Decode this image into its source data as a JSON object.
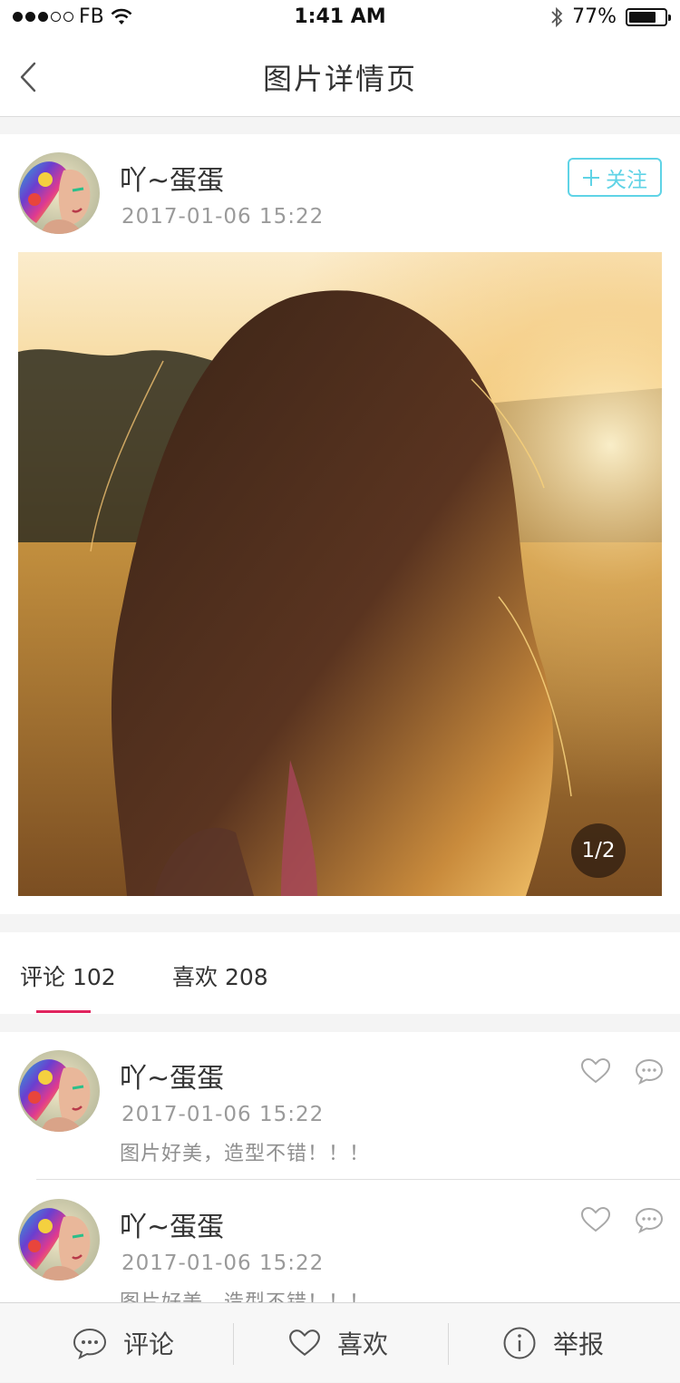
{
  "status_bar": {
    "carrier": "FB",
    "time": "1:41 AM",
    "battery": "77%",
    "battery_level": 0.77,
    "signal_filled": 3,
    "signal_total": 5
  },
  "nav": {
    "title": "图片详情页"
  },
  "post": {
    "username": "吖~蛋蛋",
    "datetime": "2017-01-06 15:22",
    "follow_label": "关注",
    "page_indicator": "1/2"
  },
  "tabs": [
    {
      "label": "评论 102"
    },
    {
      "label": "喜欢 208"
    }
  ],
  "comments": [
    {
      "username": "吖~蛋蛋",
      "datetime": "2017-01-06 15:22",
      "text": "图片好美，造型不错！！！"
    },
    {
      "username": "吖~蛋蛋",
      "datetime": "2017-01-06 15:22",
      "text": "图片好美，造型不错！！！"
    }
  ],
  "bottom_bar": {
    "comment": "评论",
    "like": "喜欢",
    "report": "举报"
  },
  "colors": {
    "accent": "#5fd3e6",
    "tab_underline": "#e0245e"
  },
  "icons": [
    "back-chevron-icon",
    "plus-icon",
    "heart-icon",
    "speech-bubble-icon",
    "info-icon",
    "wifi-icon",
    "bluetooth-icon",
    "battery-icon"
  ]
}
